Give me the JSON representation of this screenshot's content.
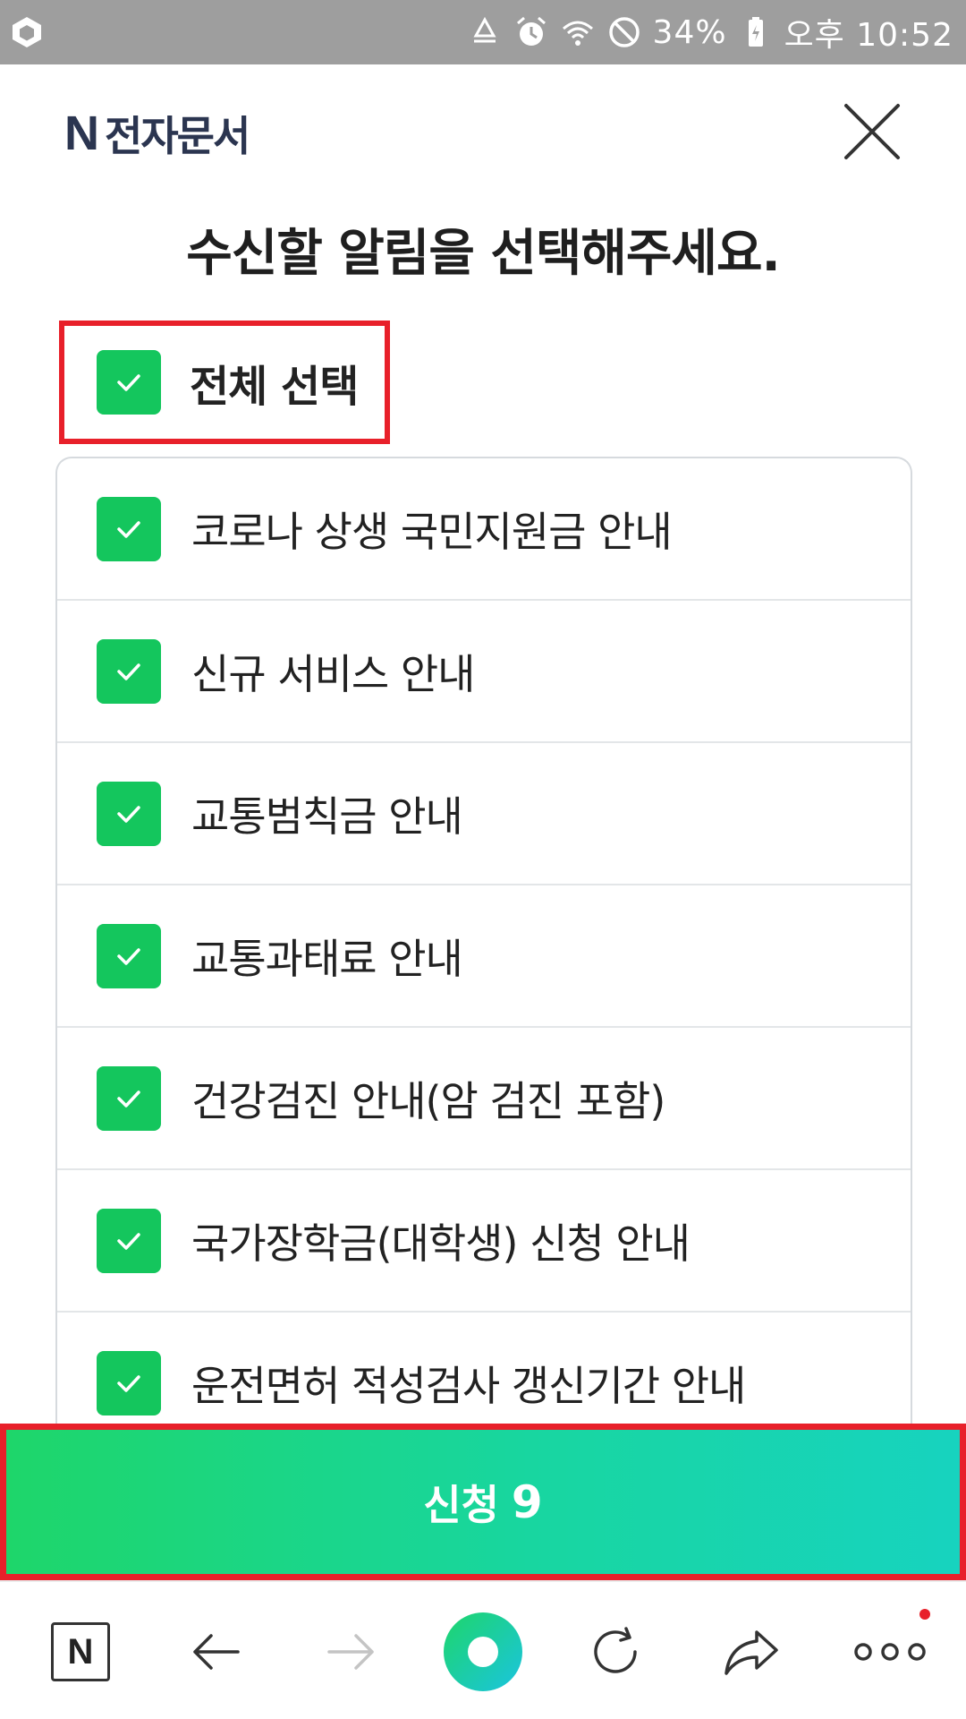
{
  "status_bar": {
    "battery": "34%",
    "time": "오후 10:52"
  },
  "header": {
    "brand_letter": "N",
    "brand_text": "전자문서"
  },
  "title": "수신할 알림을 선택해주세요.",
  "select_all": {
    "label": "전체 선택",
    "checked": true
  },
  "items": [
    {
      "label": "코로나 상생 국민지원금 안내",
      "checked": true
    },
    {
      "label": "신규 서비스 안내",
      "checked": true
    },
    {
      "label": "교통범칙금 안내",
      "checked": true
    },
    {
      "label": "교통과태료 안내",
      "checked": true
    },
    {
      "label": "건강검진 안내(암 검진 포함)",
      "checked": true
    },
    {
      "label": "국가장학금(대학생) 신청 안내",
      "checked": true
    },
    {
      "label": "운전면허 적성검사 갱신기간 안내",
      "checked": true
    }
  ],
  "submit": {
    "label": "신청",
    "count": "9"
  },
  "bottom_nav": {
    "home_letter": "N",
    "icons": [
      "naver-home-icon",
      "back-arrow-icon",
      "forward-arrow-icon",
      "green-dot-icon",
      "refresh-icon",
      "share-icon",
      "more-icon"
    ]
  },
  "colors": {
    "check_green": "#14c65d",
    "highlight_red": "#e8202a",
    "brand_navy": "#2b3550"
  }
}
